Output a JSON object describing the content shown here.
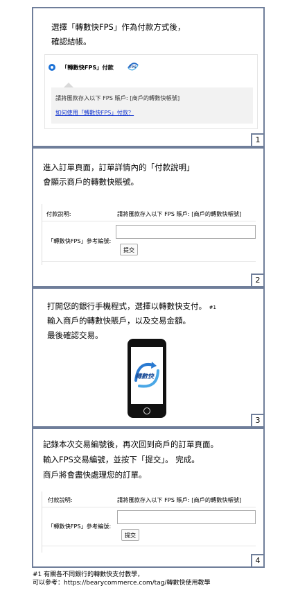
{
  "panels": [
    {
      "number": "1",
      "instruction_lines": [
        "選擇「轉數快FPS」作為付款方式後，",
        "確認結帳。"
      ],
      "payment_option_label": "「轉數快FPS」付款",
      "fps_logo_icon": "fps-logo-icon",
      "deposit_instruction": "請將匯款存入以下 FPS 賬戶: [商戶的轉數快帳號]",
      "help_link": "如何使用「轉數快FPS」付款？"
    },
    {
      "number": "2",
      "instruction_lines": [
        "進入訂單頁面，訂單詳情內的「付款說明」",
        "會顯示商戶的轉數快賬號。"
      ],
      "form": {
        "payment_note_label": "付款說明:",
        "payment_note_value": "請將匯款存入以下 FPS 賬戶: [商戶的轉數快帳號]",
        "reference_label": "「轉數快FPS」參考編號:",
        "reference_value": "",
        "submit_label": "提交"
      }
    },
    {
      "number": "3",
      "instruction_lines": [
        "打開您的銀行手機程式，選擇以轉數快支付。",
        "輸入商戶的轉數快賬戶，以及交易金額。",
        "最後確認交易。"
      ],
      "footnote_marker": "#1",
      "phone_screen_logo": "轉數快"
    },
    {
      "number": "4",
      "instruction_lines": [
        "記錄本次交易編號後，再次回到商戶的訂單頁面。",
        "輸入FPS交易編號，並按下「提交」。 完成。",
        "商戶將會盡快處理您的訂單。"
      ],
      "form": {
        "payment_note_label": "付款說明:",
        "payment_note_value": "請將匯款存入以下 FPS 賬戶: [商戶的轉數快帳號]",
        "reference_label": "「轉數快FPS」參考編號:",
        "reference_value": "",
        "submit_label": "提交"
      }
    }
  ],
  "footnote": {
    "line1": "#1  有關各不同銀行的轉數快支付教學，",
    "line2": "可以參考：https://bearycommerce.com/tag/轉數快使用教學"
  },
  "colors": {
    "border": "#6f7e9a",
    "radio": "#1d72d6",
    "link": "#1a3bd1"
  }
}
